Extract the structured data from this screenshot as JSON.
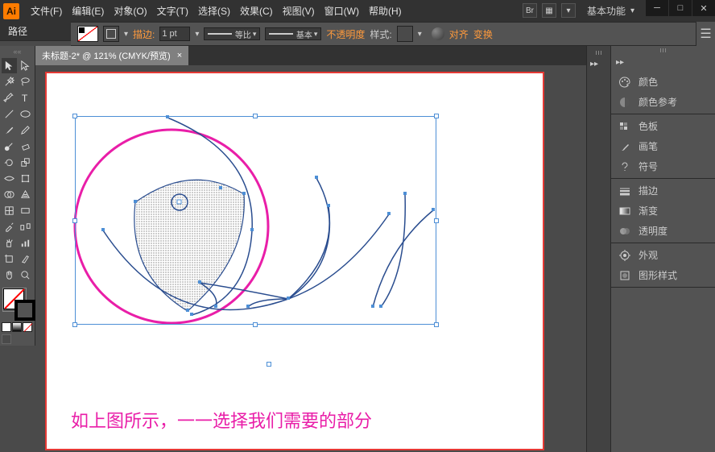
{
  "app": {
    "logo": "Ai"
  },
  "menu": [
    "文件(F)",
    "编辑(E)",
    "对象(O)",
    "文字(T)",
    "选择(S)",
    "效果(C)",
    "视图(V)",
    "窗口(W)",
    "帮助(H)"
  ],
  "title_extras": {
    "bridge": "Br",
    "basic": "基本功能"
  },
  "header_label": "路径",
  "options": {
    "stroke_label": "描边:",
    "stroke_value": "1 pt",
    "profile": "等比",
    "brush": "基本",
    "opacity": "不透明度",
    "style": "样式:",
    "align": "对齐",
    "transform": "变换"
  },
  "doc_tab": {
    "name": "未标题-2* @ 121% (CMYK/预览)",
    "close": "×"
  },
  "caption_text": "如上图所示，一一选择我们需要的部分",
  "right_panels": [
    {
      "group": [
        {
          "label": "颜色",
          "icon": "palette"
        },
        {
          "label": "颜色参考",
          "icon": "guide"
        }
      ]
    },
    {
      "group": [
        {
          "label": "色板",
          "icon": "swatch"
        },
        {
          "label": "画笔",
          "icon": "brush"
        },
        {
          "label": "符号",
          "icon": "symbol"
        }
      ]
    },
    {
      "group": [
        {
          "label": "描边",
          "icon": "stroke"
        },
        {
          "label": "渐变",
          "icon": "gradient"
        },
        {
          "label": "透明度",
          "icon": "transparency"
        }
      ]
    },
    {
      "group": [
        {
          "label": "外观",
          "icon": "appearance"
        },
        {
          "label": "图形样式",
          "icon": "graphic-style"
        }
      ]
    }
  ]
}
